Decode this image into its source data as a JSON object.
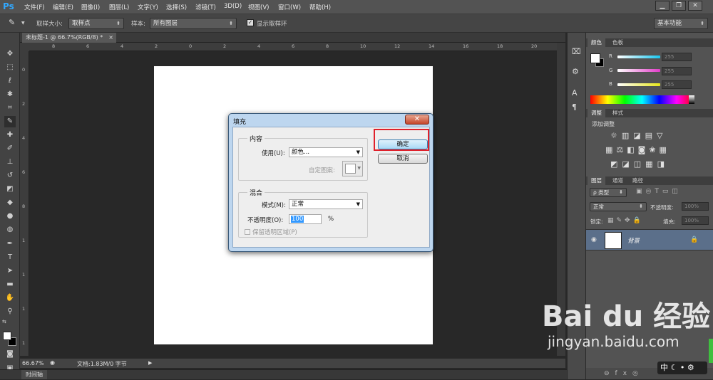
{
  "app": {
    "logo": "Ps"
  },
  "menu": [
    "文件(F)",
    "编辑(E)",
    "图像(I)",
    "图层(L)",
    "文字(Y)",
    "选择(S)",
    "滤镜(T)",
    "3D(D)",
    "视图(V)",
    "窗口(W)",
    "帮助(H)"
  ],
  "window_controls": {
    "minimize": "▁",
    "restore": "❐",
    "close": "✕"
  },
  "options": {
    "sample_size_label": "取样大小:",
    "sample_size_value": "取样点",
    "sample_label": "样本:",
    "sample_value": "所有图层",
    "show_ring_label": "显示取样环",
    "workspace": "基本功能"
  },
  "document": {
    "tab_title": "未标题-1 @ 66.7%(RGB/8) *",
    "tab_close": "×"
  },
  "ruler": {
    "h": [
      "8",
      "6",
      "4",
      "2",
      "0",
      "2",
      "4",
      "6",
      "8",
      "10",
      "12",
      "14",
      "16",
      "18",
      "20"
    ],
    "v": [
      "0",
      "2",
      "4",
      "6",
      "8",
      "1",
      "1",
      "1",
      "1",
      "1"
    ]
  },
  "status": {
    "zoom": "66.67%",
    "doc_info": "文档:1.83M/0 字节"
  },
  "timeline_tab": "时间轴",
  "panels": {
    "color_tabs": [
      "颜色",
      "色板"
    ],
    "rgb": [
      {
        "label": "R",
        "value": "255",
        "color": "#19c7f0"
      },
      {
        "label": "G",
        "value": "255",
        "color": "#e23cc8"
      },
      {
        "label": "B",
        "value": "255",
        "color": "#e6e619"
      }
    ],
    "adjust_tabs": [
      "调整",
      "样式"
    ],
    "adjust_title": "添加调整",
    "layers_tabs": [
      "图层",
      "通道",
      "路径"
    ],
    "layer_filter": "ρ 类型",
    "blend_mode": "正常",
    "opacity_label": "不透明度:",
    "opacity_value": "100%",
    "lock_label": "锁定:",
    "fill_label": "填充:",
    "fill_value": "100%",
    "layer_name": "背景"
  },
  "dialog": {
    "title": "填充",
    "close": "✕",
    "content_group": "内容",
    "use_label": "使用(U):",
    "use_value": "颜色...",
    "custom_pattern_label": "自定图案:",
    "blend_group": "混合",
    "mode_label": "模式(M):",
    "mode_value": "正常",
    "opacity_label": "不透明度(O):",
    "opacity_value": "100",
    "opacity_unit": "%",
    "preserve_label": "保留透明区域(P)",
    "ok_label": "确定",
    "cancel_label": "取消"
  },
  "watermark": {
    "brand": "Bai du 经验",
    "url": "jingyan.baidu.com"
  },
  "tray": {
    "lang": "中"
  }
}
